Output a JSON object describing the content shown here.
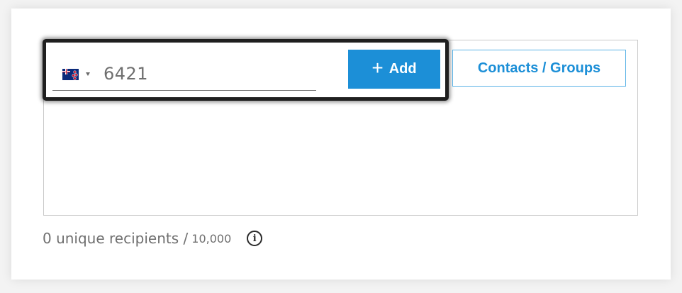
{
  "recipient_input": {
    "country": "New Zealand",
    "phone_value": "6421"
  },
  "buttons": {
    "add_icon": "+",
    "add_label": "Add",
    "contacts_label": "Contacts / Groups"
  },
  "footer": {
    "count_text": "0 unique recipients /",
    "limit_text": "10,000",
    "info_icon": "i"
  },
  "colors": {
    "accent": "#1c8fd7",
    "border": "#c9c9c9",
    "text_muted": "#6f6f6f"
  },
  "icons": [
    "nz-flag-icon",
    "chevron-down-icon",
    "plus-icon",
    "info-icon"
  ]
}
